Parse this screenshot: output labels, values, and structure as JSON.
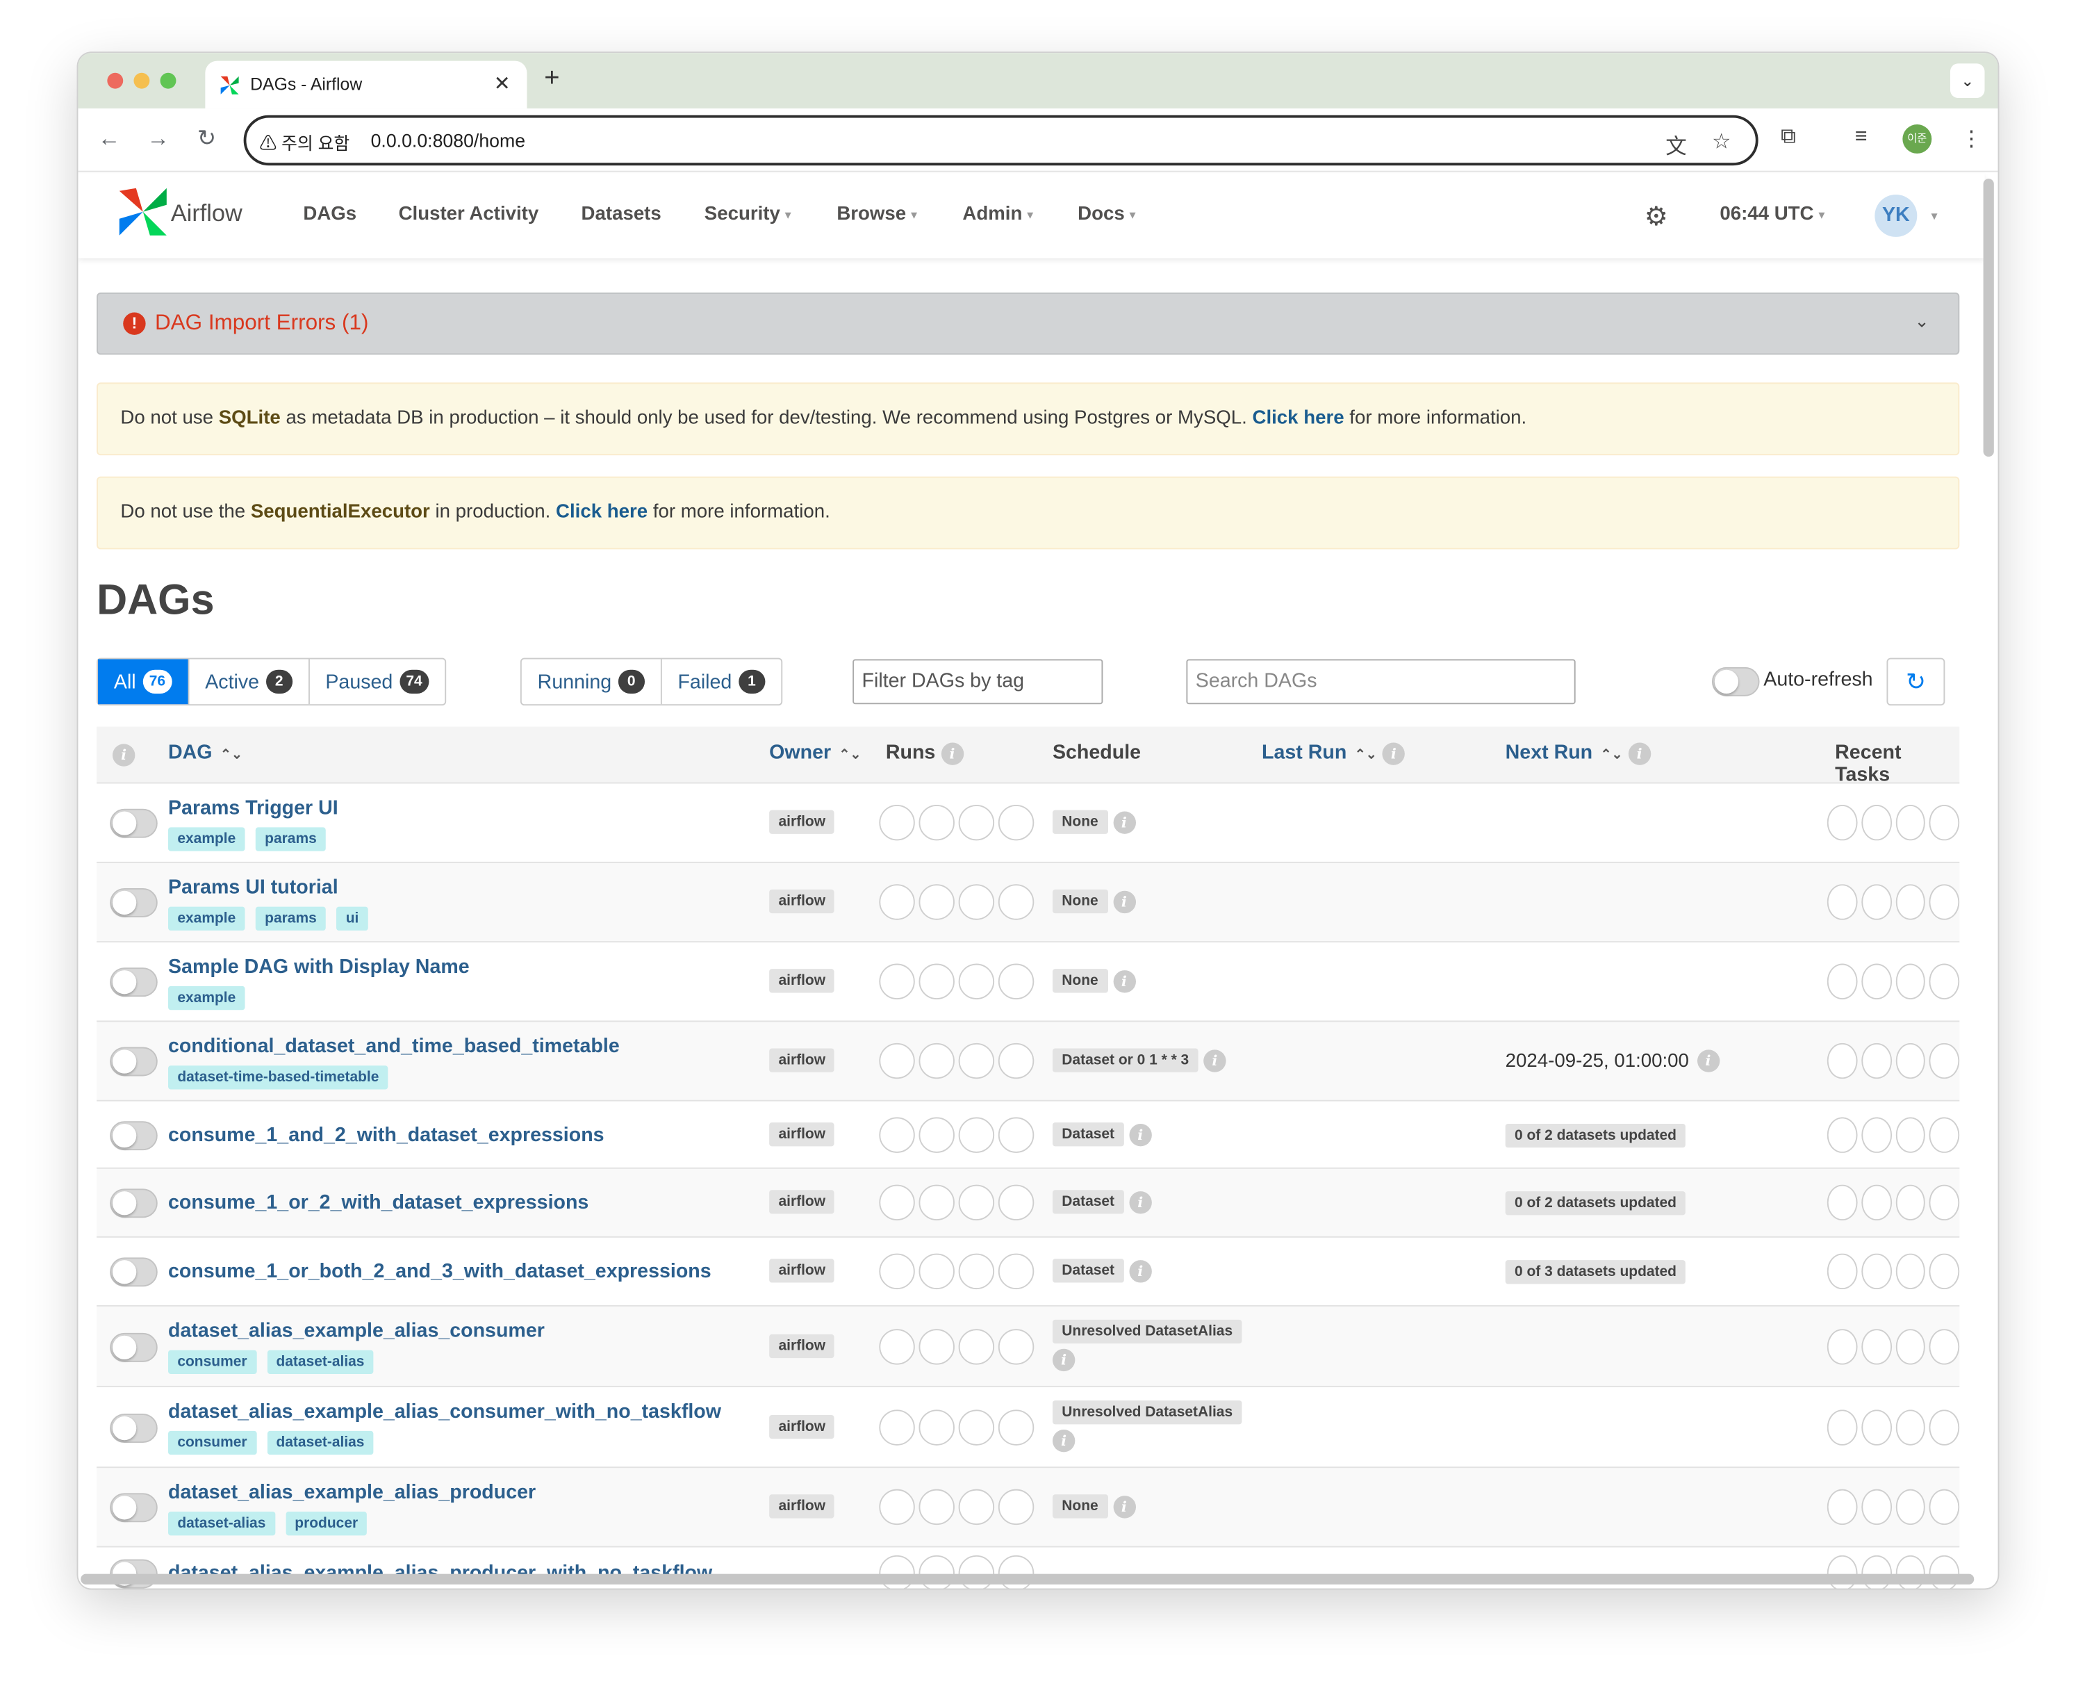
{
  "browser": {
    "tab_title": "DAGs - Airflow",
    "tab_close": "✕",
    "new_tab": "+",
    "security_warning": "주의 요함",
    "url": "0.0.0.0:8080/home",
    "profile_label": "이준"
  },
  "navbar": {
    "brand": "Airflow",
    "menu": [
      {
        "label": "DAGs",
        "has_caret": false
      },
      {
        "label": "Cluster Activity",
        "has_caret": false
      },
      {
        "label": "Datasets",
        "has_caret": false
      },
      {
        "label": "Security",
        "has_caret": true
      },
      {
        "label": "Browse",
        "has_caret": true
      },
      {
        "label": "Admin",
        "has_caret": true
      },
      {
        "label": "Docs",
        "has_caret": true
      }
    ],
    "time": "06:44 UTC",
    "user_initials": "YK"
  },
  "import_errors": {
    "label": "DAG Import Errors (1)"
  },
  "alerts": {
    "sqlite": {
      "pre": "Do not use ",
      "key": "SQLite",
      "mid": " as metadata DB in production – it should only be used for dev/testing. We recommend using Postgres or MySQL. ",
      "link": "Click here",
      "post": " for more information."
    },
    "executor": {
      "pre": "Do not use the ",
      "key": "SequentialExecutor",
      "mid": " in production. ",
      "link": "Click here",
      "post": " for more information."
    }
  },
  "page_title": "DAGs",
  "filters": {
    "status": [
      {
        "label": "All",
        "count": "76",
        "selected": true
      },
      {
        "label": "Active",
        "count": "2",
        "selected": false
      },
      {
        "label": "Paused",
        "count": "74",
        "selected": false
      }
    ],
    "runs": [
      {
        "label": "Running",
        "count": "0"
      },
      {
        "label": "Failed",
        "count": "1"
      }
    ],
    "tag_placeholder": "Filter DAGs by tag",
    "search_placeholder": "Search DAGs",
    "auto_refresh": "Auto-refresh"
  },
  "table": {
    "headers": {
      "dag": "DAG",
      "owner": "Owner",
      "runs": "Runs",
      "schedule": "Schedule",
      "last_run": "Last Run",
      "next_run": "Next Run",
      "recent_tasks": "Recent Tasks"
    },
    "rows": [
      {
        "name": "Params Trigger UI",
        "tags": [
          "example",
          "params"
        ],
        "owner": "airflow",
        "schedule": "None",
        "next_run": ""
      },
      {
        "name": "Params UI tutorial",
        "tags": [
          "example",
          "params",
          "ui"
        ],
        "owner": "airflow",
        "schedule": "None",
        "next_run": ""
      },
      {
        "name": "Sample DAG with Display Name",
        "tags": [
          "example"
        ],
        "owner": "airflow",
        "schedule": "None",
        "next_run": ""
      },
      {
        "name": "conditional_dataset_and_time_based_timetable",
        "tags": [
          "dataset-time-based-timetable"
        ],
        "owner": "airflow",
        "schedule": "Dataset or 0 1 * * 3",
        "next_run": "2024-09-25, 01:00:00"
      },
      {
        "name": "consume_1_and_2_with_dataset_expressions",
        "tags": [],
        "owner": "airflow",
        "schedule": "Dataset",
        "next_run": "0 of 2 datasets updated"
      },
      {
        "name": "consume_1_or_2_with_dataset_expressions",
        "tags": [],
        "owner": "airflow",
        "schedule": "Dataset",
        "next_run": "0 of 2 datasets updated"
      },
      {
        "name": "consume_1_or_both_2_and_3_with_dataset_expressions",
        "tags": [],
        "owner": "airflow",
        "schedule": "Dataset",
        "next_run": "0 of 3 datasets updated"
      },
      {
        "name": "dataset_alias_example_alias_consumer",
        "tags": [
          "consumer",
          "dataset-alias"
        ],
        "owner": "airflow",
        "schedule": "Unresolved DatasetAlias",
        "next_run": ""
      },
      {
        "name": "dataset_alias_example_alias_consumer_with_no_taskflow",
        "tags": [
          "consumer",
          "dataset-alias"
        ],
        "owner": "airflow",
        "schedule": "Unresolved DatasetAlias",
        "next_run": ""
      },
      {
        "name": "dataset_alias_example_alias_producer",
        "tags": [
          "dataset-alias",
          "producer"
        ],
        "owner": "airflow",
        "schedule": "None",
        "next_run": ""
      },
      {
        "name": "dataset_alias_example_alias_producer_with_no_taskflow",
        "tags": [],
        "owner": "",
        "schedule": "",
        "next_run": ""
      }
    ]
  },
  "colors": {
    "accent": "#017cee",
    "link": "#2c5f8d",
    "error": "#d9381e",
    "alert_bg": "#fcf8e3",
    "tag_bg": "#c1eff0"
  }
}
